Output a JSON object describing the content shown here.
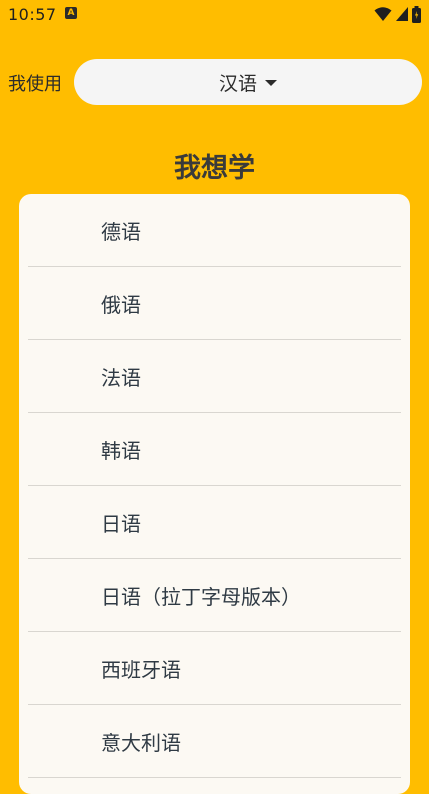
{
  "status_bar": {
    "time": "10:57",
    "notification_glyph": "A",
    "icons": [
      "wifi-icon",
      "signal-icon",
      "battery-icon"
    ]
  },
  "use_row": {
    "label": "我使用",
    "selected_language": "汉语"
  },
  "learn_section": {
    "title": "我想学",
    "languages": [
      "德语",
      "俄语",
      "法语",
      "韩语",
      "日语",
      "日语（拉丁字母版本）",
      "西班牙语",
      "意大利语"
    ]
  },
  "colors": {
    "background": "#FFBD00",
    "card": "#FCF9F3",
    "select_bg": "#F5F5F5",
    "text": "#2f3a44",
    "divider": "#D9D6D0"
  }
}
